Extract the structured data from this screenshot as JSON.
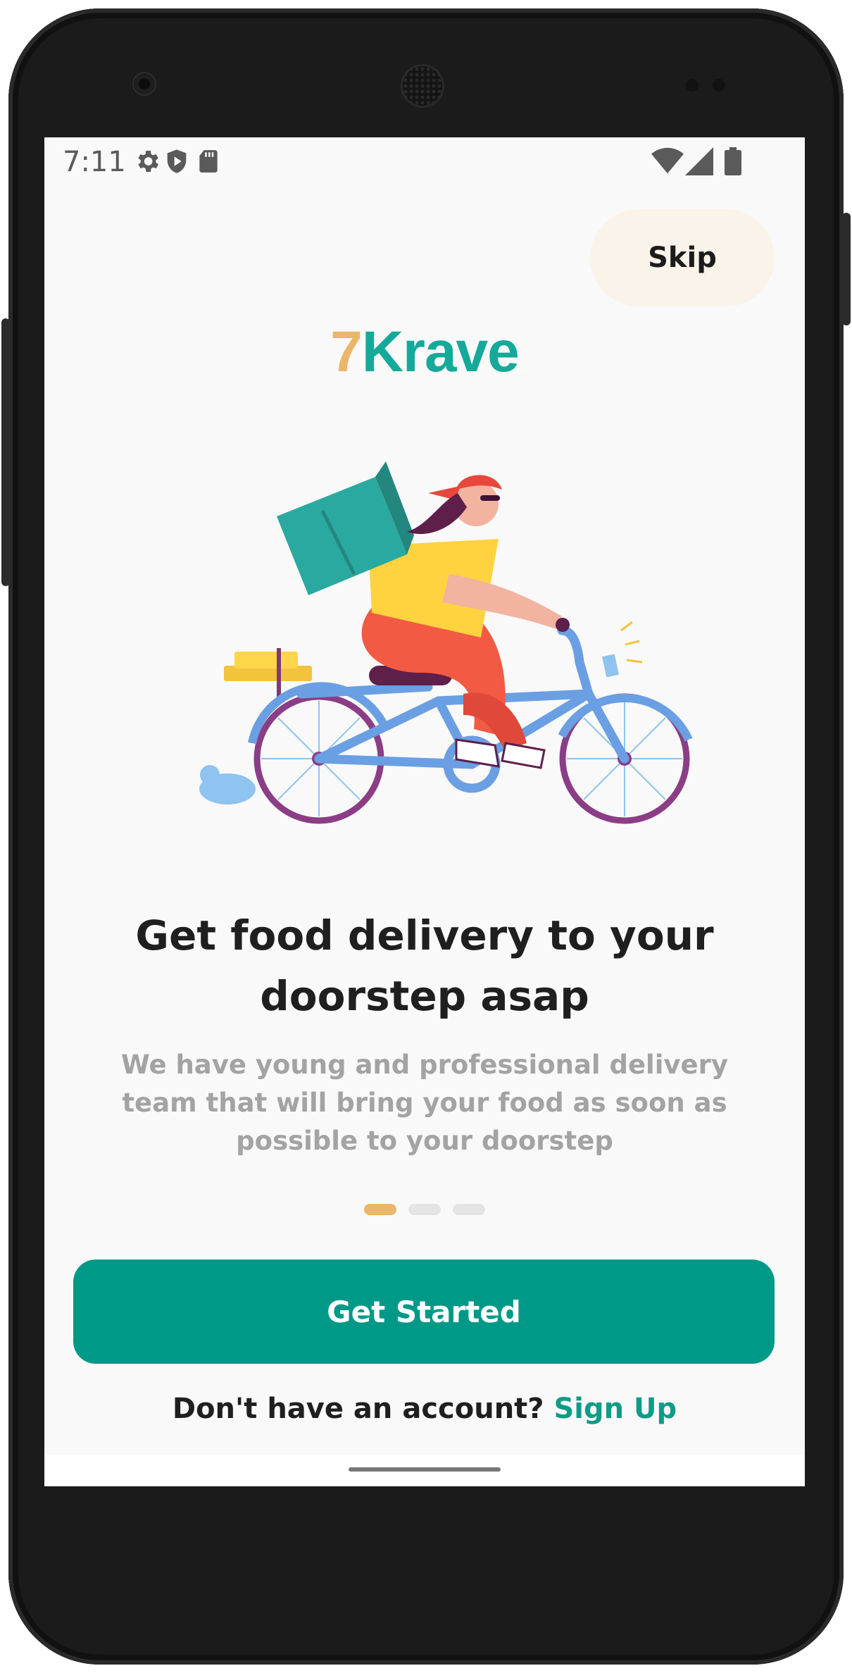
{
  "status_bar": {
    "time": "7:11",
    "left_icons": [
      "settings-icon",
      "shield-play-icon",
      "sd-card-icon"
    ],
    "right_icons": [
      "wifi-icon",
      "signal-icon",
      "battery-icon"
    ]
  },
  "header": {
    "skip_label": "Skip"
  },
  "logo": {
    "seven": "7",
    "brand": "Krave"
  },
  "onboarding": {
    "title": "Get food delivery to your doorstep asap",
    "subtitle": "We have young and professional delivery team that will bring your food as soon as possible to your doorstep",
    "page_count": 3,
    "current_page": 1
  },
  "actions": {
    "get_started_label": "Get Started",
    "account_prompt": "Don't have an account?",
    "sign_up_label": "Sign Up"
  },
  "colors": {
    "brand_teal": "#009987",
    "accent_gold": "#e9b66a",
    "skip_bg": "#faf3e9"
  }
}
